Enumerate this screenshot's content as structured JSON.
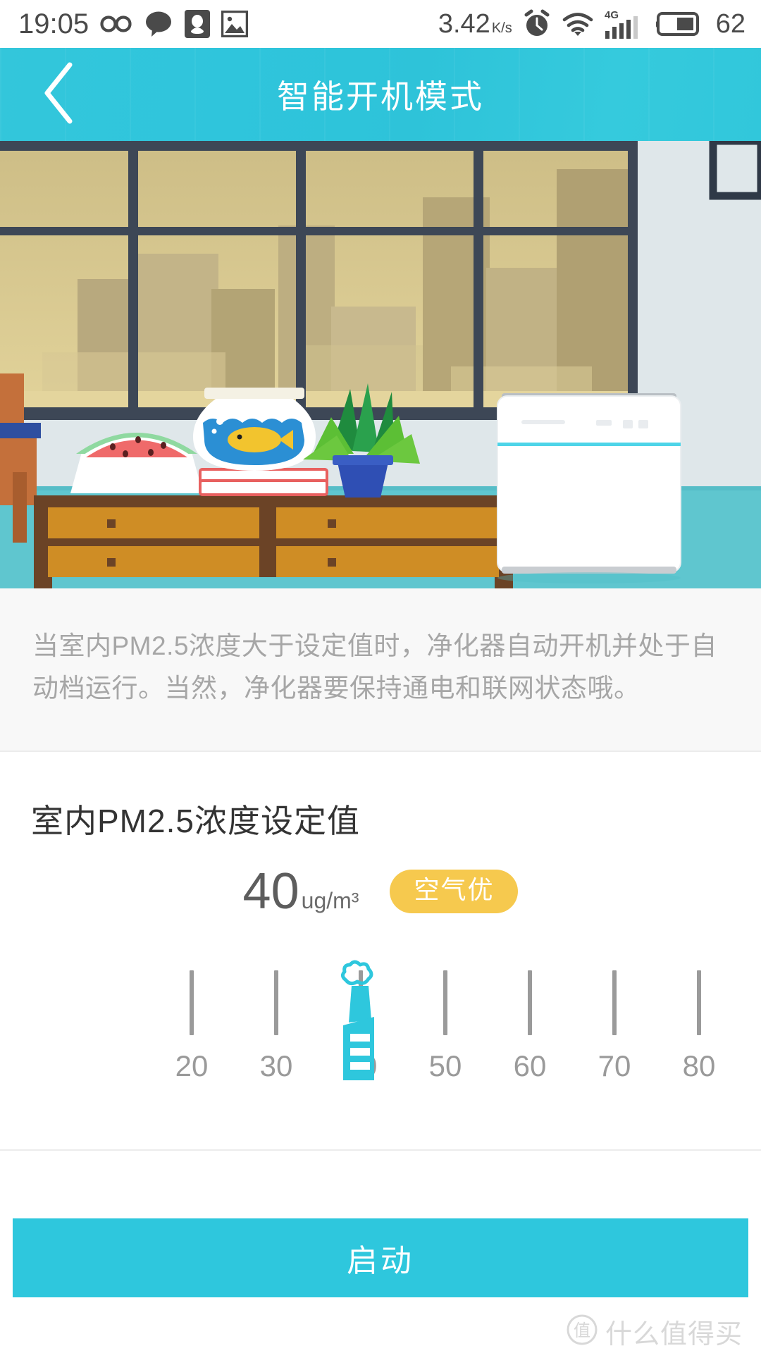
{
  "statusbar": {
    "time": "19:05",
    "icons_left": [
      "infinity-icon",
      "chat-bubble-icon",
      "qq-penguin-icon",
      "gallery-icon"
    ],
    "network_speed": "3.42",
    "network_speed_unit": "K/s",
    "icons_right": [
      "alarm-clock-icon",
      "wifi-icon",
      "signal-4g-icon",
      "battery-icon"
    ],
    "signal_label": "4G",
    "battery_percent": "62"
  },
  "header": {
    "title": "智能开机模式",
    "back_icon": "chevron-left-icon",
    "background_color": "#2ec7dd"
  },
  "hero": {
    "scene_name": "room-with-air-purifier-illustration",
    "objects": [
      "window",
      "city-skyline",
      "watermelon-bowl",
      "fishbowl",
      "books",
      "potted-plant",
      "wooden-dresser",
      "air-purifier",
      "chair"
    ]
  },
  "description": {
    "text": "当室内PM2.5浓度大于设定值时，净化器自动开机并处于自动档运行。当然，净化器要保持通电和联网状态哦。"
  },
  "setting": {
    "title": "室内PM2.5浓度设定值",
    "value": "40",
    "unit": "ug/m³",
    "badge_label": "空气优",
    "badge_color": "#f6c94e"
  },
  "slider": {
    "current_value": 40,
    "min": 20,
    "max": 80,
    "step": 10,
    "thumb_icon": "factory-smokestack-icon",
    "thumb_color": "#2ec7dd",
    "ticks": [
      {
        "label": "20",
        "value": 20
      },
      {
        "label": "30",
        "value": 30
      },
      {
        "label": "40",
        "value": 40
      },
      {
        "label": "50",
        "value": 50
      },
      {
        "label": "60",
        "value": 60
      },
      {
        "label": "70",
        "value": 70
      },
      {
        "label": "80",
        "value": 80
      }
    ]
  },
  "footer": {
    "start_button_label": "启动",
    "start_button_color": "#2ec7dd",
    "watermark_text": "什么值得买",
    "watermark_logo_char": "值"
  }
}
